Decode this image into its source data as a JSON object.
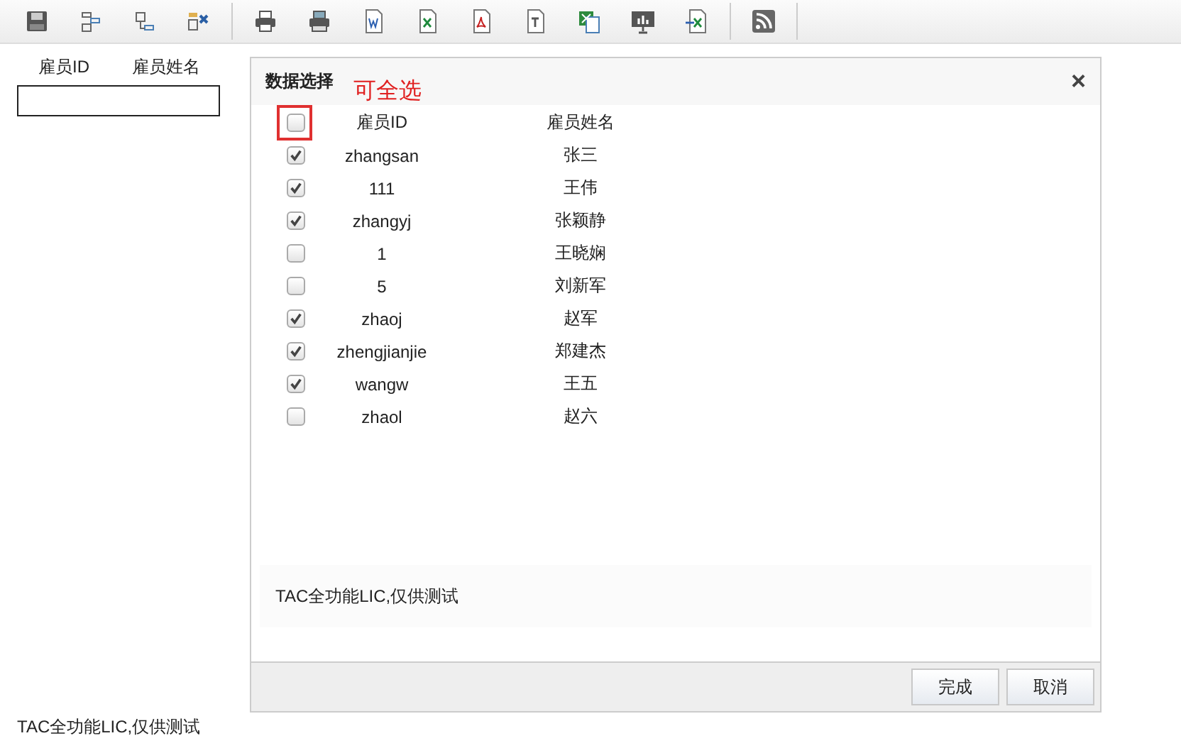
{
  "page": {
    "columns": [
      "雇员ID",
      "雇员姓名"
    ],
    "footer": "TAC全功能LIC,仅供测试"
  },
  "dialog": {
    "title": "数据选择",
    "close": "×",
    "annotation": "可全选",
    "select_all": {
      "checked": false
    },
    "columns": [
      "雇员ID",
      "雇员姓名"
    ],
    "rows": [
      {
        "id": "zhangsan",
        "name": "张三",
        "checked": true
      },
      {
        "id": "111",
        "name": "王伟",
        "checked": true
      },
      {
        "id": "zhangyj",
        "name": "张颖静",
        "checked": true
      },
      {
        "id": "1",
        "name": "王晓娴",
        "checked": false
      },
      {
        "id": "5",
        "name": "刘新军",
        "checked": false
      },
      {
        "id": "zhaoj",
        "name": "赵军",
        "checked": true
      },
      {
        "id": "zhengjianjie",
        "name": "郑建杰",
        "checked": true
      },
      {
        "id": "wangw",
        "name": "王五",
        "checked": true
      },
      {
        "id": "zhaol",
        "name": "赵六",
        "checked": false
      }
    ],
    "note": "TAC全功能LIC,仅供测试",
    "buttons": [
      "完成",
      "取消"
    ]
  }
}
